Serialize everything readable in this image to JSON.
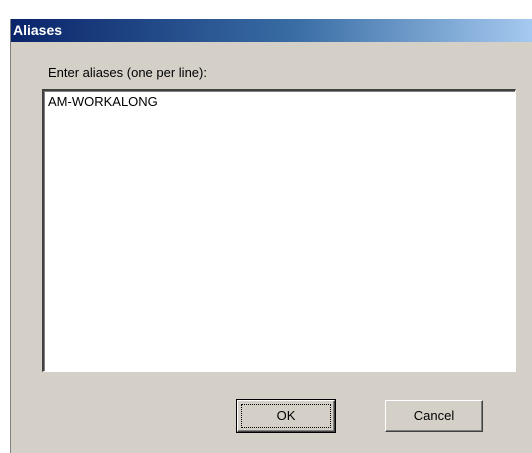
{
  "dialog": {
    "title": "Aliases",
    "field_label": "Enter aliases (one per line):",
    "aliases_value": "AM-WORKALONG",
    "ok_label": "OK",
    "cancel_label": "Cancel"
  },
  "colors": {
    "titlebar_start": "#0a246a",
    "titlebar_end": "#a6caf0",
    "dialog_bg": "#d4d0c8"
  }
}
